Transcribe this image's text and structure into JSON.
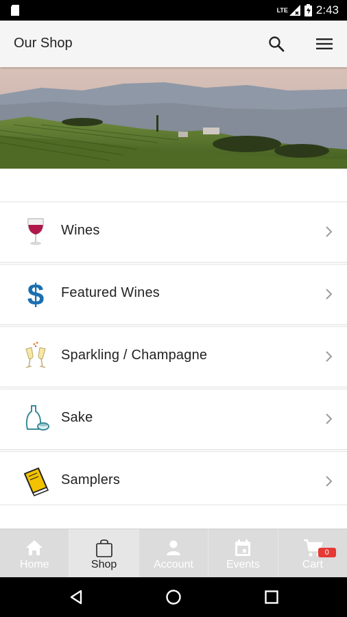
{
  "status_bar": {
    "time": "2:43",
    "network": "LTE"
  },
  "app_bar": {
    "title": "Our Shop",
    "icons": [
      "search-icon",
      "menu-icon"
    ]
  },
  "categories": [
    {
      "label": "Wines",
      "icon": "wine-glass-icon"
    },
    {
      "label": "Featured Wines",
      "icon": "dollar-icon"
    },
    {
      "label": "Sparkling / Champagne",
      "icon": "champagne-icon"
    },
    {
      "label": "Sake",
      "icon": "sake-icon"
    },
    {
      "label": "Samplers",
      "icon": "book-icon"
    }
  ],
  "bottom_nav": {
    "tabs": [
      {
        "label": "Home",
        "icon": "home-icon",
        "active": false
      },
      {
        "label": "Shop",
        "icon": "bag-icon",
        "active": true
      },
      {
        "label": "Account",
        "icon": "person-icon",
        "active": false
      },
      {
        "label": "Events",
        "icon": "calendar-icon",
        "active": false
      },
      {
        "label": "Cart",
        "icon": "cart-icon",
        "active": false,
        "badge": "0"
      }
    ]
  },
  "colors": {
    "appbar_bg": "#f5f5f5",
    "badge": "#e53935",
    "dollar_blue": "#1a6fb0"
  }
}
